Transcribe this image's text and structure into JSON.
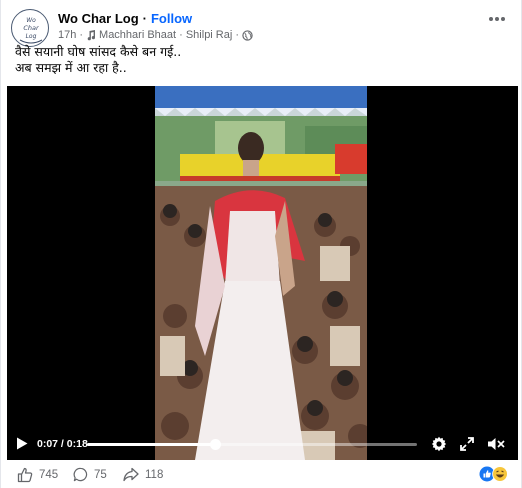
{
  "post": {
    "author": "Wo Char Log",
    "separator": "·",
    "follow_label": "Follow",
    "time": "17h",
    "song": "Machhari Bhaat · Shilpi Raj",
    "audience_icon": "globe-icon",
    "more_icon": "more-options-icon",
    "avatar_text": [
      "Wo",
      "Char",
      "Log"
    ],
    "caption_line1": "वैसे सयानी घोष सांसद कैसे बन गई..",
    "caption_line2": "अब समझ में आ रहा है.."
  },
  "video": {
    "current_time": "0:07",
    "duration": "0:18",
    "time_display": "0:07 / 0:18",
    "progress_fraction": 0.389,
    "icons": [
      "play-icon",
      "gear-icon",
      "expand-icon",
      "mute-icon"
    ]
  },
  "footer": {
    "likes": "745",
    "comments": "75",
    "shares": "118",
    "reaction_icons": [
      "like-reaction-icon",
      "haha-reaction-icon"
    ]
  },
  "colors": {
    "follow": "#0866ff",
    "secondary_text": "#65676b",
    "video_bg": "#000000"
  }
}
